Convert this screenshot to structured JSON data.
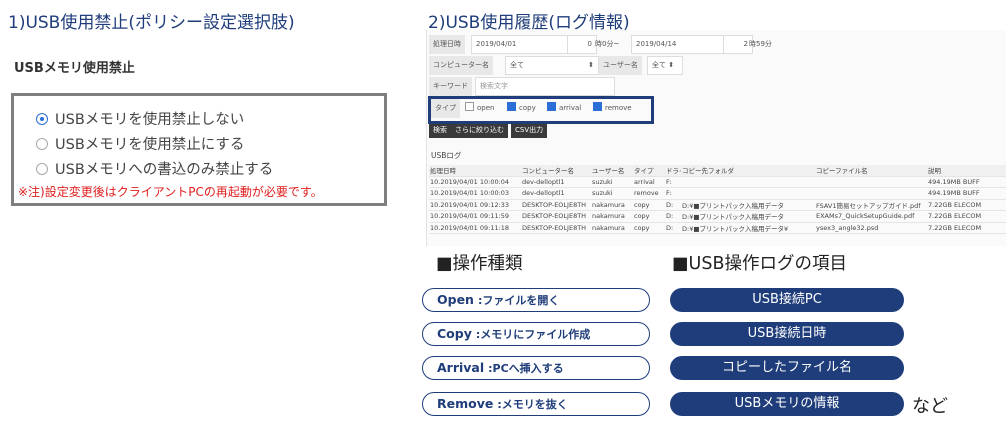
{
  "left": {
    "title": "1)USB使用禁止(ポリシー設定選択肢)",
    "subtitle": "USBメモリ使用禁止",
    "options": [
      {
        "label": "USBメモリを使用禁止しない",
        "selected": true
      },
      {
        "label": "USBメモリを使用禁止にする",
        "selected": false
      },
      {
        "label": "USBメモリへの書込のみ禁止する",
        "selected": false
      }
    ],
    "note": "※注)設定変更後はクライアントPCの再起動が必要です。"
  },
  "right": {
    "title": "2)USB使用履歴(ログ情報)",
    "filters": {
      "date_label": "処理日時",
      "date_from": "2019/04/01",
      "hour_from": "0",
      "hour_from_suffix": "時0分~",
      "date_to": "2019/04/14",
      "hour_to": "2",
      "hour_to_suffix": "時59分",
      "computer_label": "コンピューター名",
      "computer_value": "全て",
      "user_label": "ユーザー名",
      "user_value": "全て",
      "keyword_label": "キーワード",
      "keyword_placeholder": "検索文字",
      "type_label": "タイプ",
      "types": [
        {
          "label": "open",
          "checked": false
        },
        {
          "label": "copy",
          "checked": true
        },
        {
          "label": "arrival",
          "checked": true
        },
        {
          "label": "remove",
          "checked": true
        }
      ]
    },
    "buttons": {
      "search": "検索",
      "refine": "さらに絞り込む",
      "csv": "CSV出力"
    },
    "log_heading": "USBログ",
    "table": {
      "columns": [
        "処理日時",
        "コンピューター名",
        "ユーザー名",
        "タイプ",
        "ドライ",
        "コピー先フォルダ",
        "コピーファイル名",
        "説明"
      ],
      "rows": [
        [
          "10.2019/04/01 10:00:04",
          "dev-delloptl1",
          "suzuki",
          "arrival",
          "F:",
          "",
          "",
          "494.19MB BUFF"
        ],
        [
          "10.2019/04/01 10:00:03",
          "dev-delloptl1",
          "suzuki",
          "remove",
          "F:",
          "",
          "",
          "494.19MB BUFF"
        ],
        [
          "10.2019/04/01 09:12:33",
          "DESKTOP-EOLJE8TH",
          "nakamura",
          "copy",
          "D:",
          "D:¥■プリントパック入稿用データ",
          "FSAV1簡易セットアップガイド.pdf",
          "7.22GB ELECOM"
        ],
        [
          "10.2019/04/01 09:11:59",
          "DESKTOP-EOLJE8TH",
          "nakamura",
          "copy",
          "D:",
          "D:¥■プリントパック入稿用データ",
          "EXAMs7_QuickSetupGuide.pdf",
          "7.22GB ELECOM"
        ],
        [
          "10.2019/04/01 09:11:18",
          "DESKTOP-EOLJE8TH",
          "nakamura",
          "copy",
          "D:",
          "D:¥■プリントパック入稿用データ¥",
          "ysex3_angle32.psd",
          "7.22GB ELECOM"
        ]
      ]
    }
  },
  "operations": {
    "heading": "■操作種類",
    "items": [
      {
        "name": "Open",
        "desc": ":ファイルを開く"
      },
      {
        "name": "Copy",
        "desc": ":メモリにファイル作成"
      },
      {
        "name": "Arrival",
        "desc": ":PCへ挿入する"
      },
      {
        "name": "Remove",
        "desc": ":メモリを抜く"
      }
    ]
  },
  "log_items": {
    "heading": "■USB操作ログの項目",
    "items": [
      "USB接続PC",
      "USB接続日時",
      "コピーしたファイル名",
      "USBメモリの情報"
    ],
    "etc": "など"
  },
  "colors": {
    "navy": "#1f3d7a",
    "note_red": "#e01e1e",
    "radio_blue": "#2b6fd6"
  }
}
